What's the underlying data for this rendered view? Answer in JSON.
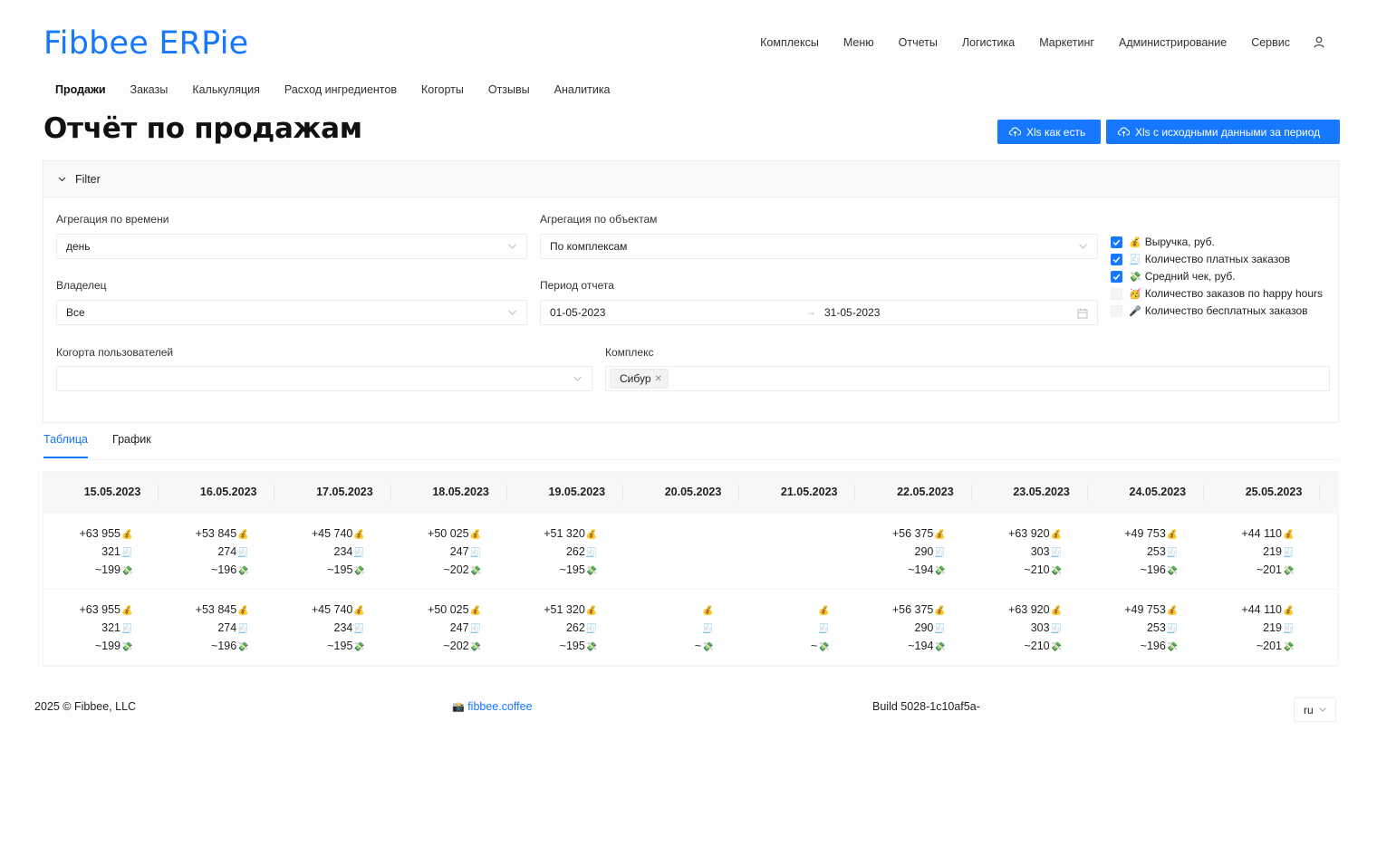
{
  "app": {
    "logo": "Fibbee ERPie"
  },
  "top_nav": [
    "Комплексы",
    "Меню",
    "Отчеты",
    "Логистика",
    "Маркетинг",
    "Администрирование",
    "Сервис"
  ],
  "sub_nav": {
    "active": "Продажи",
    "items": [
      "Продажи",
      "Заказы",
      "Калькуляция",
      "Расход ингредиентов",
      "Когорты",
      "Отзывы",
      "Аналитика"
    ]
  },
  "page": {
    "title": "Отчёт по продажам"
  },
  "actions": {
    "xls_as_is": "Xls как есть",
    "xls_raw": "Xls с исходными данными за период"
  },
  "filter": {
    "title": "Filter",
    "time_agg": {
      "label": "Агрегация по времени",
      "value": "день"
    },
    "object_agg": {
      "label": "Агрегация по объектам",
      "value": "По комплексам"
    },
    "owner": {
      "label": "Владелец",
      "value": "Все"
    },
    "period": {
      "label": "Период отчета",
      "from": "01-05-2023",
      "to": "31-05-2023"
    },
    "cohort": {
      "label": "Когорта пользователей",
      "value": ""
    },
    "complex": {
      "label": "Комплекс",
      "tag": "Сибур"
    },
    "metrics": [
      {
        "emoji": "💰",
        "label": "Выручка, руб.",
        "checked": true
      },
      {
        "emoji": "🧾",
        "label": "Количество платных заказов",
        "checked": true
      },
      {
        "emoji": "💸",
        "label": "Средний чек, руб.",
        "checked": true
      },
      {
        "emoji": "🥳",
        "label": "Количество заказов по happy hours",
        "checked": false
      },
      {
        "emoji": "🎤",
        "label": "Количество бесплатных заказов",
        "checked": false
      }
    ]
  },
  "tabs": {
    "active": "Таблица",
    "items": [
      "Таблица",
      "График"
    ]
  },
  "table": {
    "icons": {
      "revenue": "💰",
      "orders": "🧾",
      "avg": "💸"
    },
    "columns": [
      "15.05.2023",
      "16.05.2023",
      "17.05.2023",
      "18.05.2023",
      "19.05.2023",
      "20.05.2023",
      "21.05.2023",
      "22.05.2023",
      "23.05.2023",
      "24.05.2023",
      "25.05.2023"
    ],
    "rows": [
      {
        "revenue": [
          "+63 955",
          "+53 845",
          "+45 740",
          "+50 025",
          "+51 320",
          "",
          "",
          "+56 375",
          "+63 920",
          "+49 753",
          "+44 110"
        ],
        "orders": [
          "321",
          "274",
          "234",
          "247",
          "262",
          "",
          "",
          "290",
          "303",
          "253",
          "219"
        ],
        "avg": [
          "~199",
          "~196",
          "~195",
          "~202",
          "~195",
          "",
          "",
          "~194",
          "~210",
          "~196",
          "~201"
        ],
        "show_empty_icons": false
      },
      {
        "revenue": [
          "+63 955",
          "+53 845",
          "+45 740",
          "+50 025",
          "+51 320",
          "",
          "",
          "+56 375",
          "+63 920",
          "+49 753",
          "+44 110"
        ],
        "orders": [
          "321",
          "274",
          "234",
          "247",
          "262",
          "",
          "",
          "290",
          "303",
          "253",
          "219"
        ],
        "avg": [
          "~199",
          "~196",
          "~195",
          "~202",
          "~195",
          "~",
          "~",
          "~194",
          "~210",
          "~196",
          "~201"
        ],
        "show_empty_icons": true
      }
    ]
  },
  "footer": {
    "copyright": "2025 © Fibbee, LLC",
    "link_emoji": "📸",
    "link_text": "fibbee.coffee",
    "build": "Build 5028-1c10af5a-",
    "lang": "ru"
  },
  "colors": {
    "accent": "#1677ff"
  }
}
